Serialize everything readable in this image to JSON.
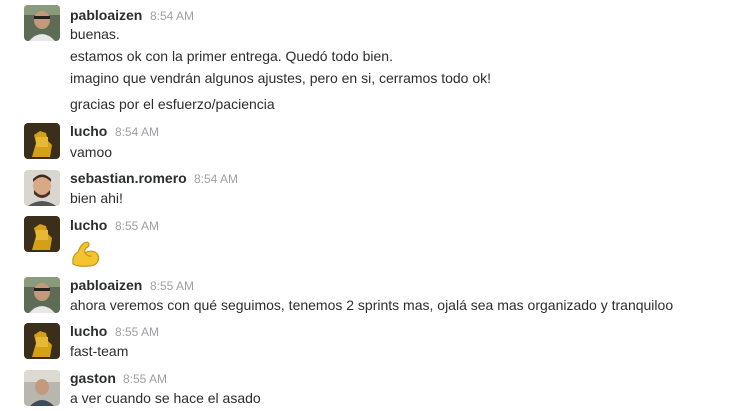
{
  "messages": [
    {
      "author": "pabloaizen",
      "time": "8:54 AM",
      "lines": [
        "buenas.",
        "estamos ok con la primer entrega. Quedó todo bien.",
        "imagino que vendrán algunos ajustes, pero en si, cerramos todo ok!",
        "gracias por el esfuerzo/paciencia"
      ]
    },
    {
      "author": "lucho",
      "time": "8:54 AM",
      "lines": [
        "vamoo"
      ]
    },
    {
      "author": "sebastian.romero",
      "time": "8:54 AM",
      "lines": [
        "bien ahi!"
      ]
    },
    {
      "author": "lucho",
      "time": "8:55 AM",
      "emoji": "flexed-biceps-icon"
    },
    {
      "author": "pabloaizen",
      "time": "8:55 AM",
      "lines": [
        "ahora veremos con qué seguimos, tenemos 2 sprints mas, ojalá sea mas organizado y tranquiloo"
      ]
    },
    {
      "author": "lucho",
      "time": "8:55 AM",
      "lines": [
        "fast-team"
      ]
    },
    {
      "author": "gaston",
      "time": "8:55 AM",
      "lines": [
        "a ver cuando se hace el asado"
      ]
    }
  ]
}
